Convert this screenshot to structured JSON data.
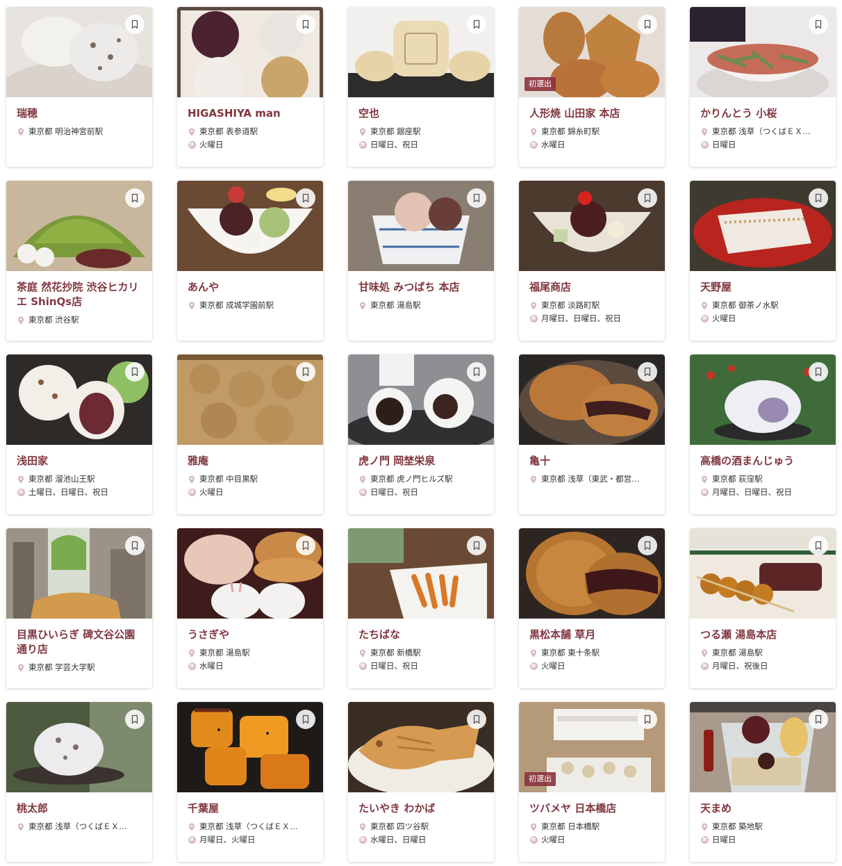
{
  "colors": {
    "shop_name": "#80373f",
    "badge_bg": "#8c323e",
    "pin_icon": "#d8b9bc"
  },
  "closed_icon_glyph": "休",
  "shops": [
    {
      "name": "瑞穂",
      "location": "東京都 明治神宮前駅",
      "closed": "",
      "badge": "",
      "photo": "daifuku-on-glass-plate"
    },
    {
      "name": "HIGASHIYA man",
      "location": "東京都 表参道駅",
      "closed": "火曜日",
      "badge": "",
      "photo": "assorted-manju-box"
    },
    {
      "name": "空也",
      "location": "東京都 銀座駅",
      "closed": "日曜日、祝日",
      "badge": "",
      "photo": "monaka-wafers"
    },
    {
      "name": "人形焼 山田家 本店",
      "location": "東京都 錦糸町駅",
      "closed": "水曜日",
      "badge": "初選出",
      "photo": "ningyo-yaki"
    },
    {
      "name": "かりんとう 小桜",
      "location": "東京都 浅草（つくばＥＸ…",
      "closed": "日曜日",
      "badge": "",
      "photo": "karinto-bowl"
    },
    {
      "name": "茶庭 然花抄院 渋谷ヒカリエ ShinQs店",
      "location": "東京都 渋谷駅",
      "closed": "",
      "badge": "",
      "photo": "matcha-shaved-ice"
    },
    {
      "name": "あんや",
      "location": "東京都 成城学園前駅",
      "closed": "",
      "badge": "",
      "photo": "anmitsu-bowl"
    },
    {
      "name": "甘味処 みつばち 本店",
      "location": "東京都 湯島駅",
      "closed": "",
      "badge": "",
      "photo": "ice-cream-cup"
    },
    {
      "name": "福尾商店",
      "location": "東京都 淡路町駅",
      "closed": "月曜日、日曜日、祝日",
      "badge": "",
      "photo": "anmitsu-cherry"
    },
    {
      "name": "天野屋",
      "location": "東京都 御茶ノ水駅",
      "closed": "火曜日",
      "badge": "",
      "photo": "kuzumochi-red-plate"
    },
    {
      "name": "浅田家",
      "location": "東京都 溜池山王駅",
      "closed": "土曜日、日曜日、祝日",
      "badge": "",
      "photo": "mame-daifuku"
    },
    {
      "name": "雅庵",
      "location": "東京都 中目黒駅",
      "closed": "火曜日",
      "badge": "",
      "photo": "warabimochi-kinako"
    },
    {
      "name": "虎ノ門 岡埜栄泉",
      "location": "東京都 虎ノ門ヒルズ駅",
      "closed": "日曜日、祝日",
      "badge": "",
      "photo": "daifuku-cut"
    },
    {
      "name": "亀十",
      "location": "東京都 浅草（東武・都営…",
      "closed": "",
      "badge": "",
      "photo": "dorayaki-plate"
    },
    {
      "name": "高橋の酒まんじゅう",
      "location": "東京都 荻窪駅",
      "closed": "月曜日、日曜日、祝日",
      "badge": "",
      "photo": "sake-manju"
    },
    {
      "name": "目黒ひいらぎ 碑文谷公園通り店",
      "location": "東京都 学芸大学駅",
      "closed": "",
      "badge": "",
      "photo": "taiyaki-parfait"
    },
    {
      "name": "うさぎや",
      "location": "東京都 湯島駅",
      "closed": "水曜日",
      "badge": "",
      "photo": "dorayaki-rabbit"
    },
    {
      "name": "たちばな",
      "location": "東京都 新橋駅",
      "closed": "日曜日、祝日",
      "badge": "",
      "photo": "karinto-plate"
    },
    {
      "name": "黒松本舗 草月",
      "location": "東京都 東十条駅",
      "closed": "火曜日",
      "badge": "",
      "photo": "dorayaki-cut"
    },
    {
      "name": "つる瀬 湯島本店",
      "location": "東京都 湯島駅",
      "closed": "月曜日、祝後日",
      "badge": "",
      "photo": "dango-skewer"
    },
    {
      "name": "桃太郎",
      "location": "東京都 浅草（つくばＥＸ…",
      "closed": "",
      "badge": "",
      "photo": "daifuku-dark-plate"
    },
    {
      "name": "千葉屋",
      "location": "東京都 浅草（つくばＥＸ…",
      "closed": "月曜日、火曜日",
      "badge": "",
      "photo": "daigaku-imo"
    },
    {
      "name": "たいやき わかば",
      "location": "東京都 四ツ谷駅",
      "closed": "水曜日、日曜日",
      "badge": "",
      "photo": "taiyaki"
    },
    {
      "name": "ツバメヤ 日本橋店",
      "location": "東京都 日本橋駅",
      "closed": "火曜日",
      "badge": "初選出",
      "photo": "warabimochi-boxes"
    },
    {
      "name": "天まめ",
      "location": "東京都 築地駅",
      "closed": "日曜日",
      "badge": "",
      "photo": "mitsumame-cup"
    }
  ]
}
